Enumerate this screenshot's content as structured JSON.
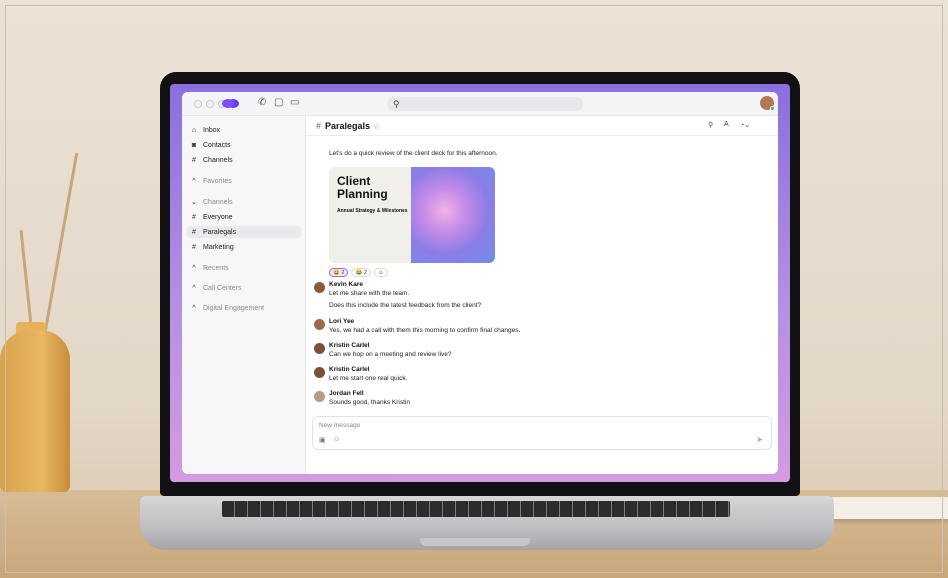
{
  "titlebar": {
    "search_icon": "search-icon",
    "icons": [
      "phone-icon",
      "chat-icon",
      "video-icon"
    ]
  },
  "sidebar": {
    "items": [
      {
        "icon": "inbox-icon",
        "label": "Inbox"
      },
      {
        "icon": "contacts-icon",
        "label": "Contacts"
      },
      {
        "icon": "hash-icon",
        "label": "Channels"
      }
    ],
    "favorites_label": "Favorites",
    "channels_label": "Channels",
    "channels": [
      {
        "label": "Everyone"
      },
      {
        "label": "Paralegals",
        "active": true
      },
      {
        "label": "Marketing"
      }
    ],
    "recents_label": "Recents",
    "call_centers_label": "Call Centers",
    "digital_engagement_label": "Digital Engagement"
  },
  "chat": {
    "channel_name": "Paralegals",
    "header_icons": [
      "search-icon",
      "font-icon",
      "more-icon"
    ],
    "intro_text": "Let's do a quick review of the client deck for this afternoon.",
    "card": {
      "title": "Client Planning",
      "subtitle": "Annual Strategy & Milestones"
    },
    "reactions": [
      {
        "emoji": "😀",
        "count": "2",
        "selected": true
      },
      {
        "emoji": "😂",
        "count": "2",
        "selected": false
      },
      {
        "emoji": "☺",
        "count": "",
        "selected": false
      }
    ],
    "messages": [
      {
        "author": "Kevin Kare",
        "lines": [
          "Let me share with the team.",
          "Does this include the latest feedback from the client?"
        ]
      },
      {
        "author": "Lori Yee",
        "lines": [
          "Yes, we had a call with them this morning to confirm final changes."
        ]
      },
      {
        "author": "Kristin Carlel",
        "lines": [
          "Can we hop on a meeting and review live?"
        ]
      },
      {
        "author": "Kristin Carlel",
        "lines": [
          "Let me start one real quick."
        ]
      },
      {
        "author": "Jordan Fell",
        "lines": [
          "Sounds good, thanks Kristin"
        ]
      }
    ],
    "composer": {
      "placeholder": "New message"
    }
  },
  "colors": {
    "accent": "#7b4dff",
    "online": "#2ebd5d"
  }
}
